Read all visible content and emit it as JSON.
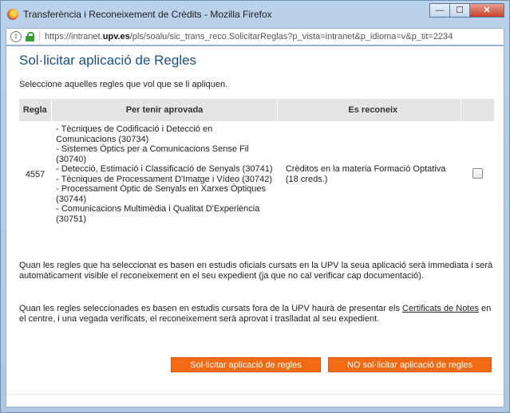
{
  "window": {
    "title": "Transferència i Reconeixement de Crèdits - Mozilla Firefox",
    "buttons": {
      "minimize": "—",
      "maximize": "☐",
      "close": "✕"
    }
  },
  "urlbar": {
    "prefix": "https://intranet.",
    "domain": "upv.es",
    "path": "/pls/soalu/sic_trans_reco.SolicitarReglas?p_vista=intranet&p_idioma=v&p_tit=2234"
  },
  "page": {
    "title": "Sol·licitar aplicació de Regles",
    "intro": "Seleccione aquelles regles que vol que se li apliquen."
  },
  "table": {
    "headers": {
      "regla": "Regla",
      "per_tenir": "Per tenir aprovada",
      "reconeix": "Es reconeix"
    },
    "rows": [
      {
        "regla": "4557",
        "per_tenir": [
          "- Tècniques de Codificació i Detecció en Comunicacions (30734)",
          "- Sistemes Òptics per a Comunicacions Sense Fil (30740)",
          "- Detecció, Estimació i Classificació de Senyals (30741)",
          "- Tècniques de Processament D'Imatge i Vídeo (30742)",
          "- Processament Òptic de Senyals en Xarxes Òptiques (30744)",
          "- Comunicacions Multimèdia i Qualitat D'Experiència (30751)"
        ],
        "reconeix": "Crèditos en la materia Formació Optativa (18 creds.)",
        "checked": false
      }
    ]
  },
  "paragraphs": {
    "p1": "Quan les regles que ha seleccionat es basen en estudis oficials cursats en la UPV la seua aplicació serà immediata i serà automàticament visible el reconeixement en el seu expedient (ja que no cal verificar cap documentació).",
    "p2_before": "Quan les regles seleccionades es basen en estudis cursats fora de la UPV haurà de presentar els ",
    "p2_link": "Certificats de Notes",
    "p2_after": " en el centre, i una vegada verificats, el reconeixement serà aprovat i traslladat al seu expedient."
  },
  "buttons": {
    "request": "Sol·licitar aplicació de regles",
    "no_request": "NO sol·licitar aplicació de regles"
  },
  "colors": {
    "accent_button": "#f26a12",
    "title": "#1f4f7f"
  }
}
